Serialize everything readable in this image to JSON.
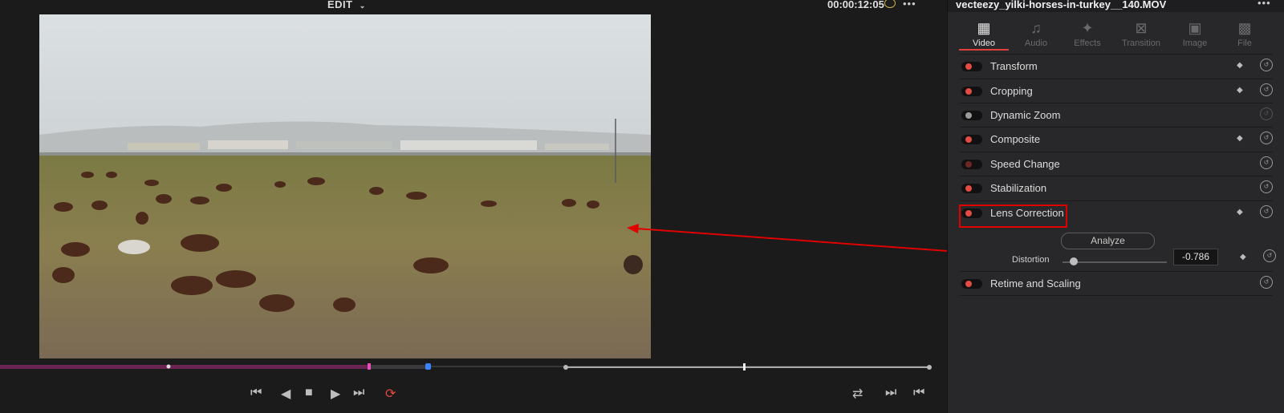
{
  "viewer": {
    "mode_label": "EDIT",
    "timecode": "00:00:12:05",
    "preview_alt": "Video preview of horses grazing on a grassy field"
  },
  "inspector": {
    "clip_title": "vecteezy_yilki-horses-in-turkey__140.MOV",
    "tabs": [
      {
        "label": "Video",
        "icon": "film-icon"
      },
      {
        "label": "Audio",
        "icon": "music-note-icon"
      },
      {
        "label": "Effects",
        "icon": "magic-wand-icon"
      },
      {
        "label": "Transition",
        "icon": "transition-icon"
      },
      {
        "label": "Image",
        "icon": "image-icon"
      },
      {
        "label": "File",
        "icon": "file-icon"
      }
    ],
    "sections": [
      {
        "label": "Transform"
      },
      {
        "label": "Cropping"
      },
      {
        "label": "Dynamic Zoom"
      },
      {
        "label": "Composite"
      },
      {
        "label": "Speed Change"
      },
      {
        "label": "Stabilization"
      },
      {
        "label": "Lens Correction"
      },
      {
        "label": "Retime and Scaling"
      }
    ],
    "lens": {
      "analyze_label": "Analyze",
      "distortion_label": "Distortion",
      "distortion_value": "-0.786"
    }
  },
  "colors": {
    "accent": "#e34b43",
    "highlight": "#e00000"
  }
}
